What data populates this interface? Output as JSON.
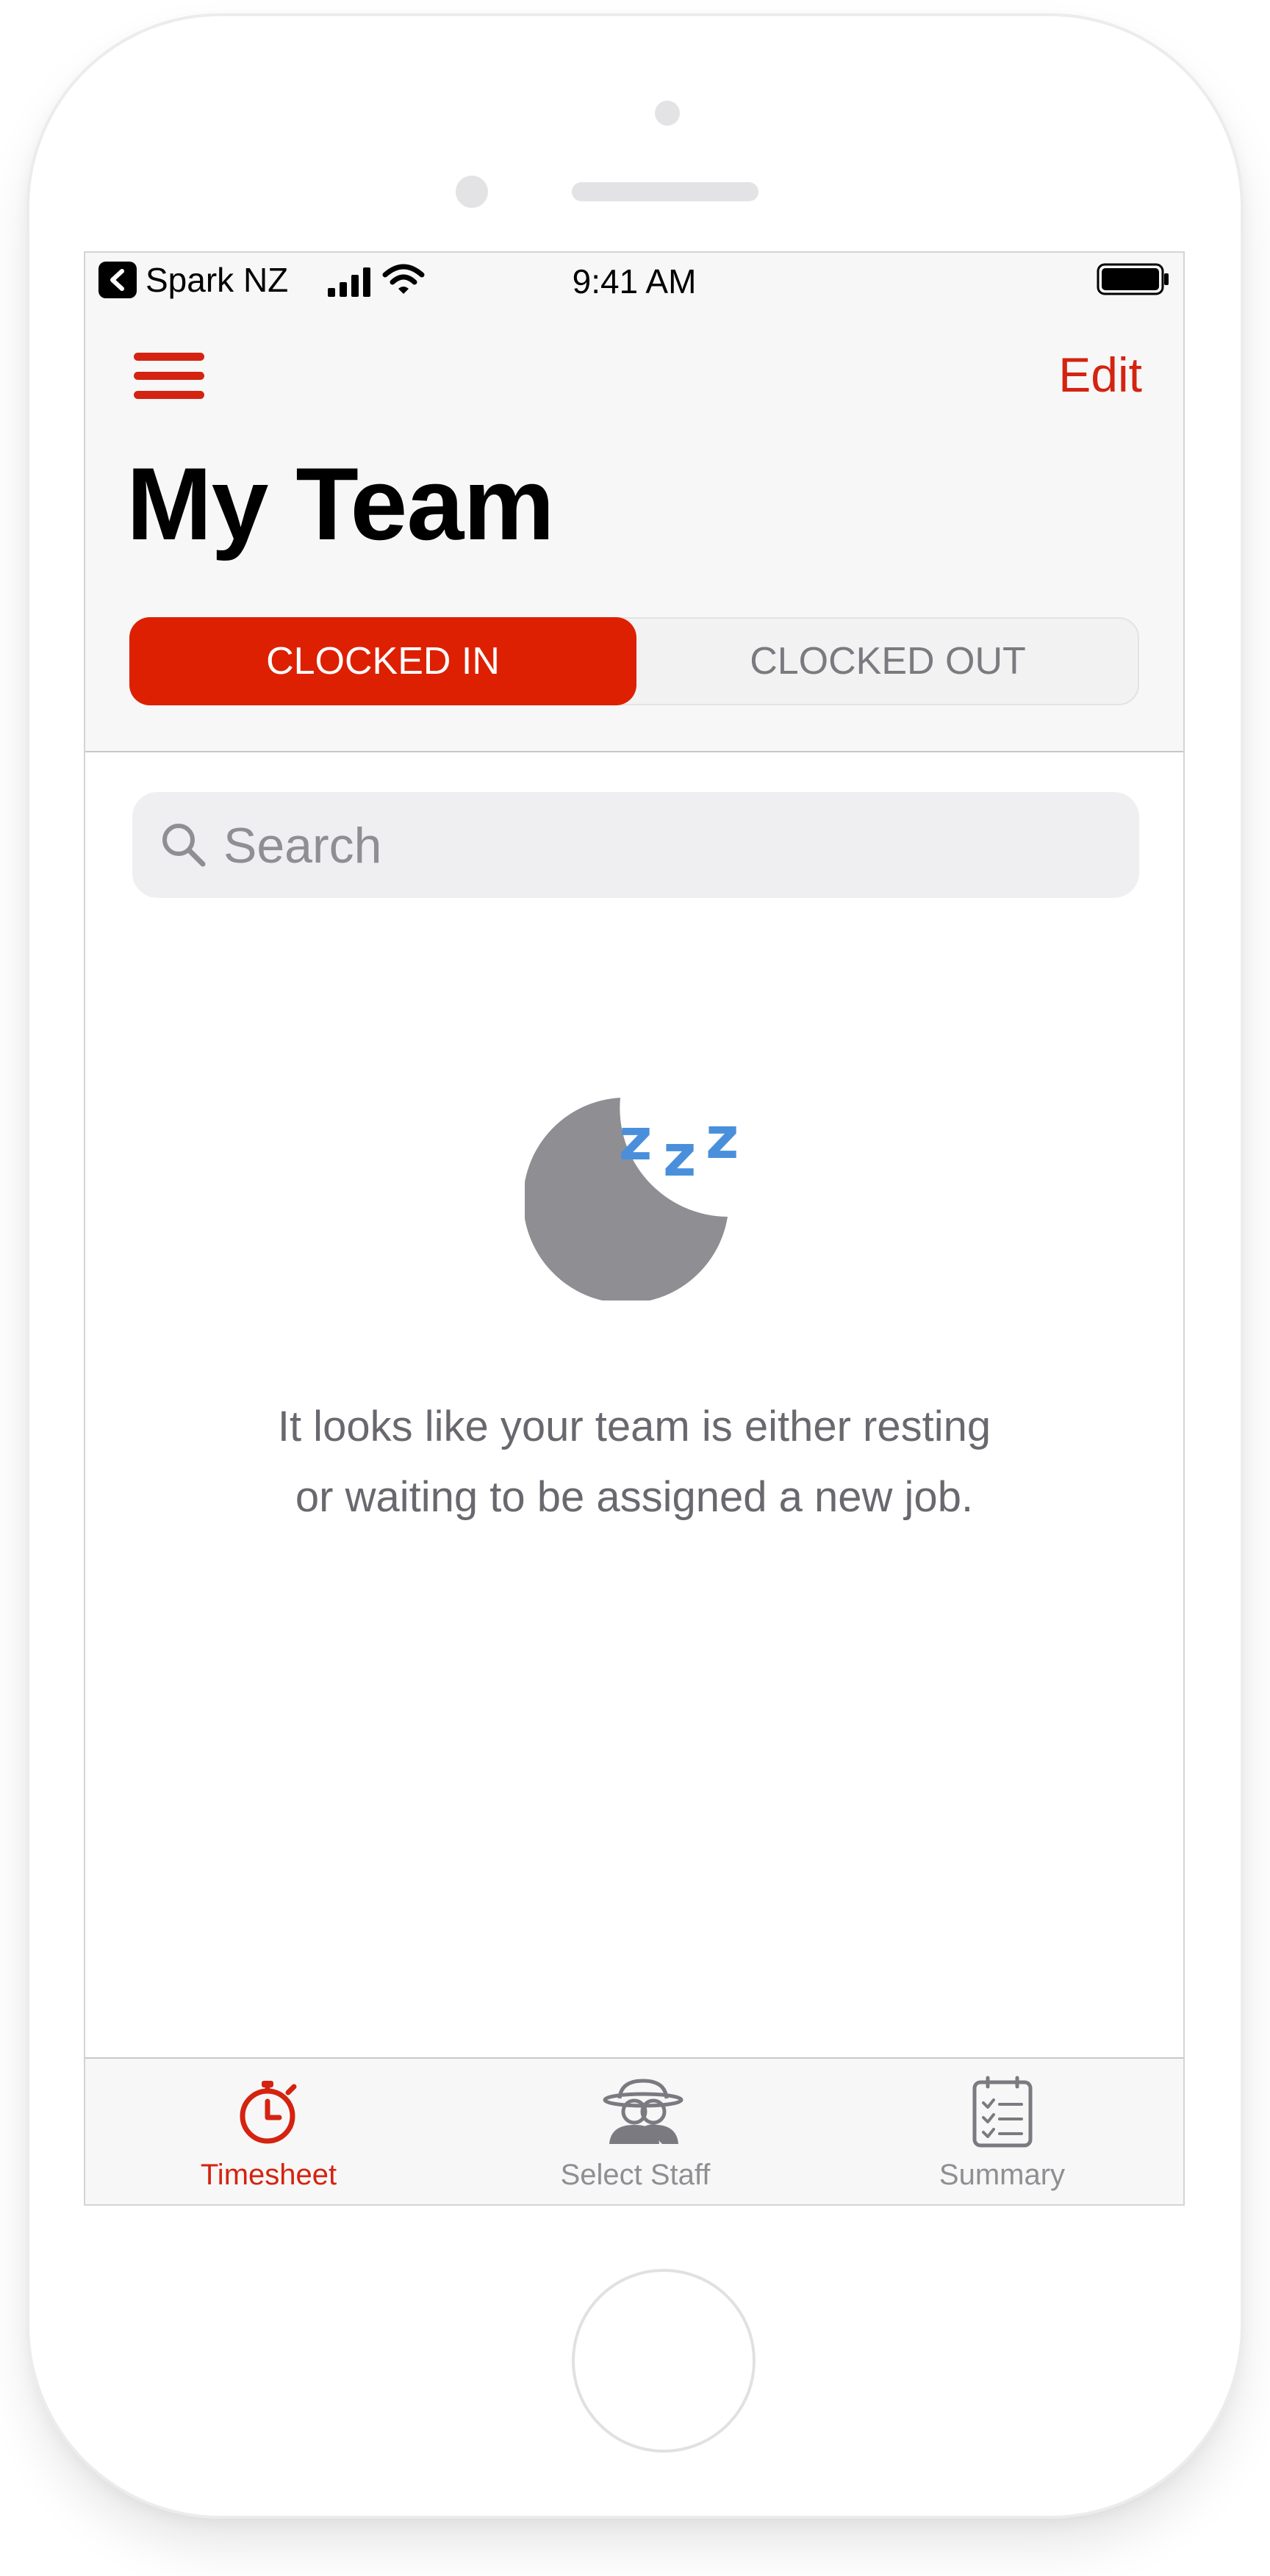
{
  "status_bar": {
    "carrier": "Spark NZ",
    "time": "9:41 AM",
    "back_icon": "back-chevron-icon",
    "signal_icon": "cellular-signal-icon",
    "wifi_icon": "wifi-icon",
    "battery_icon": "battery-icon"
  },
  "nav": {
    "menu_icon": "hamburger-menu-icon",
    "edit_label": "Edit",
    "title": "My Team"
  },
  "segmented_control": {
    "options": [
      {
        "label": "CLOCKED IN",
        "selected": true
      },
      {
        "label": "CLOCKED OUT",
        "selected": false
      }
    ]
  },
  "search": {
    "placeholder": "Search",
    "value": "",
    "icon": "search-icon"
  },
  "empty_state": {
    "icon": "sleeping-moon-icon",
    "message_line1": "It looks like your team is either resting",
    "message_line2": "or waiting to be assigned a new job."
  },
  "tab_bar": {
    "tabs": [
      {
        "label": "Timesheet",
        "icon": "stopwatch-icon",
        "active": true
      },
      {
        "label": "Select Staff",
        "icon": "staff-icon",
        "active": false
      },
      {
        "label": "Summary",
        "icon": "checklist-icon",
        "active": false
      }
    ]
  },
  "colors": {
    "accent": "#dd2002",
    "accent_text": "#d42310",
    "moon": "#8e8e93",
    "zzz": "#4a8fdb",
    "inactive": "#8e8e93"
  }
}
